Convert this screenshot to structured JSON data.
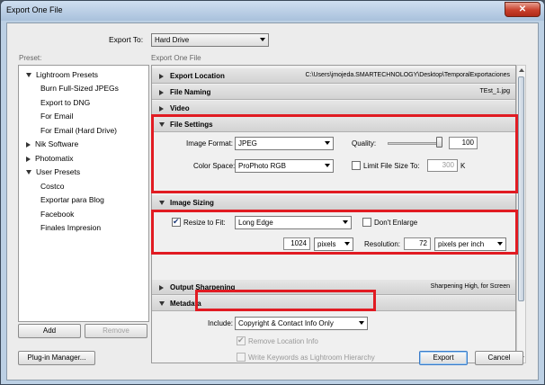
{
  "window": {
    "title": "Export One File",
    "close_glyph": "✕"
  },
  "export_to": {
    "label": "Export To:",
    "value": "Hard Drive"
  },
  "preset_header": "Preset:",
  "export_header": "Export One File",
  "presets": [
    {
      "label": "Lightroom Presets",
      "level": 0,
      "expanded": true
    },
    {
      "label": "Burn Full-Sized JPEGs",
      "level": 1
    },
    {
      "label": "Export to DNG",
      "level": 1
    },
    {
      "label": "For Email",
      "level": 1
    },
    {
      "label": "For Email (Hard Drive)",
      "level": 1
    },
    {
      "label": "Nik Software",
      "level": 0,
      "expanded": false
    },
    {
      "label": "Photomatix",
      "level": 0,
      "expanded": false
    },
    {
      "label": "User Presets",
      "level": 0,
      "expanded": true
    },
    {
      "label": "Costco",
      "level": 1
    },
    {
      "label": "Exportar para Blog",
      "level": 1
    },
    {
      "label": "Facebook",
      "level": 1
    },
    {
      "label": "Finales Impresion",
      "level": 1
    }
  ],
  "buttons": {
    "add": "Add",
    "remove": "Remove",
    "plugin_manager": "Plug-in Manager...",
    "export": "Export",
    "cancel": "Cancel"
  },
  "sections": {
    "export_location": {
      "title": "Export Location",
      "summary": "C:\\Users\\jmojeda.SMARTECHNOLOGY\\Desktop\\TemporalExportaciones"
    },
    "file_naming": {
      "title": "File Naming",
      "summary": "TEst_1.jpg"
    },
    "video": {
      "title": "Video"
    },
    "file_settings": {
      "title": "File Settings",
      "image_format_label": "Image Format:",
      "image_format": "JPEG",
      "quality_label": "Quality:",
      "quality": "100",
      "color_space_label": "Color Space:",
      "color_space": "ProPhoto RGB",
      "limit_label": "Limit File Size To:",
      "limit_value": "300",
      "limit_unit": "K",
      "limit_checked": false
    },
    "image_sizing": {
      "title": "Image Sizing",
      "resize_label": "Resize to Fit:",
      "resize_checked": true,
      "resize_mode": "Long Edge",
      "dont_enlarge_label": "Don't Enlarge",
      "dont_enlarge_checked": false,
      "size_value": "1024",
      "size_unit": "pixels",
      "resolution_label": "Resolution:",
      "resolution": "72",
      "resolution_unit": "pixels per inch"
    },
    "output_sharpening": {
      "title": "Output Sharpening",
      "summary": "Sharpening High, for Screen"
    },
    "metadata": {
      "title": "Metadata",
      "include_label": "Include:",
      "include_value": "Copyright & Contact Info Only",
      "remove_location_label": "Remove Location Info",
      "remove_location_checked": true,
      "write_keywords_label": "Write Keywords as Lightroom Hierarchy",
      "write_keywords_checked": false
    }
  },
  "colors": {
    "highlight": "#e11b22",
    "titlebar": "#bcd0e4"
  }
}
